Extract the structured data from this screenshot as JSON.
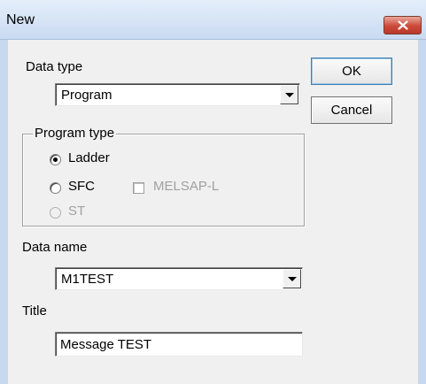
{
  "window": {
    "title": "New",
    "close_icon": "close-icon"
  },
  "data_type": {
    "label": "Data type",
    "selected": "Program"
  },
  "buttons": {
    "ok": "OK",
    "cancel": "Cancel"
  },
  "program_type": {
    "legend": "Program type",
    "options": [
      {
        "label": "Ladder",
        "checked": true,
        "enabled": true
      },
      {
        "label": "SFC",
        "checked": false,
        "enabled": true
      },
      {
        "label": "ST",
        "checked": false,
        "enabled": false
      }
    ],
    "melsap_label": "MELSAP-L",
    "melsap_checked": false,
    "melsap_enabled": false
  },
  "data_name": {
    "label": "Data name",
    "selected": "M1TEST"
  },
  "title_field": {
    "label": "Title",
    "value": "Message TEST"
  },
  "colors": {
    "close_button": "#cc4a3a",
    "frame": "#c7d9ef",
    "background": "#f0f0f0"
  }
}
